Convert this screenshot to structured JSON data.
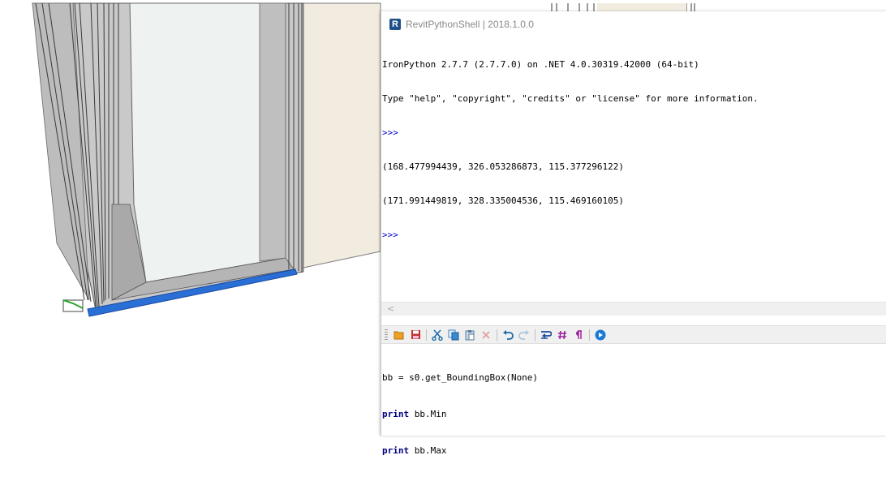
{
  "window": {
    "title": "RevitPythonShell | 2018.1.0.0",
    "icon_letter": "R"
  },
  "output": {
    "lines": [
      {
        "text": "IronPython 2.7.7 (2.7.7.0) on .NET 4.0.30319.42000 (64-bit)",
        "kind": "text"
      },
      {
        "text": "Type \"help\", \"copyright\", \"credits\" or \"license\" for more information.",
        "kind": "text"
      },
      {
        "text": ">>>",
        "kind": "prompt"
      },
      {
        "text": "(168.477994439, 326.053286873, 115.377296122)",
        "kind": "text"
      },
      {
        "text": "(171.991449819, 328.335004536, 115.469160105)",
        "kind": "text"
      },
      {
        "text": ">>>",
        "kind": "prompt"
      }
    ]
  },
  "scrollbar": {
    "left_arrow": "<"
  },
  "toolbar": {
    "buttons": [
      {
        "name": "open-icon",
        "color": "#f0a020"
      },
      {
        "name": "save-icon",
        "color": "#c03030"
      },
      {
        "name": "cut-icon",
        "color": "#1a6aa8"
      },
      {
        "name": "copy-icon",
        "color": "#3a8ad0"
      },
      {
        "name": "paste-icon",
        "color": "#5a7a9a"
      },
      {
        "name": "delete-icon",
        "color": "#e0a0a0"
      },
      {
        "name": "undo-icon",
        "color": "#1a6aa8"
      },
      {
        "name": "redo-icon",
        "color": "#a8c8e0"
      },
      {
        "name": "word-wrap-icon",
        "color": "#1a4a9a"
      },
      {
        "name": "line-numbers-icon",
        "color": "#9a1a9a"
      },
      {
        "name": "show-whitespace-icon",
        "color": "#9a1a9a"
      },
      {
        "name": "run-icon",
        "color": "#1a7ad8"
      }
    ]
  },
  "editor": {
    "line1": {
      "code": "bb = s0.get_BoundingBox(None)"
    },
    "line2": {
      "keyword": "print",
      "rest": " bb.Min"
    },
    "line3": {
      "keyword": "print",
      "rest": " bb.Max"
    }
  },
  "colors": {
    "prompt": "#0000cc",
    "keyword": "#000080",
    "selection_blue": "#2a6fd6",
    "wall_beige": "#f2ece0"
  }
}
